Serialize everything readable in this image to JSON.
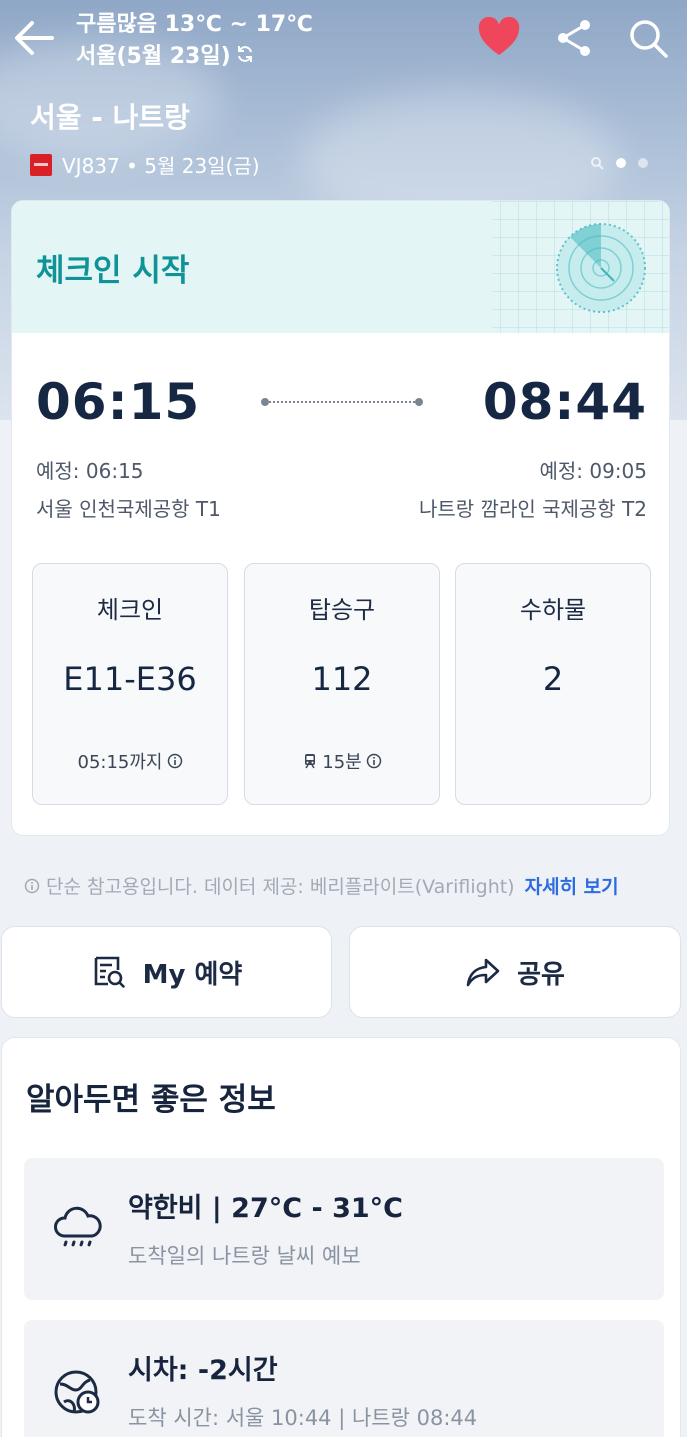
{
  "header": {
    "weather_line": "구름많음 13℃ ~ 17℃",
    "location_line": "서울(5월 23일)",
    "route": "서울 - 나트랑",
    "flight": "VJ837 • 5월 23일(금)"
  },
  "flight_card": {
    "status": "체크인 시작",
    "departure_time": "06:15",
    "arrival_time": "08:44",
    "departure_scheduled": "예정: 06:15",
    "arrival_scheduled": "예정: 09:05",
    "departure_airport": "서울 인천국제공항 T1",
    "arrival_airport": "나트랑 깜라인 국제공항 T2",
    "tiles": [
      {
        "label": "체크인",
        "value": "E11-E36",
        "note": "05:15까지"
      },
      {
        "label": "탑승구",
        "value": "112",
        "note": "15분"
      },
      {
        "label": "수하물",
        "value": "2",
        "note": ""
      }
    ]
  },
  "disclaimer": {
    "text": "단순 참고용입니다. 데이터 제공: 베리플라이트(Variflight)",
    "link": "자세히 보기"
  },
  "actions": {
    "my_booking": "My 예약",
    "share": "공유"
  },
  "info": {
    "title": "알아두면 좋은 정보",
    "items": [
      {
        "heading": "약한비 | 27°C - 31°C",
        "sub": "도착일의 나트랑 날씨 예보",
        "icon": "rain-cloud-icon"
      },
      {
        "heading": "시차: -2시간",
        "sub": "도착 시간: 서울 10:44 | 나트랑 08:44",
        "icon": "globe-clock-icon"
      }
    ]
  },
  "colors": {
    "status_teal": "#0f9397",
    "heart": "#f0465c",
    "link_blue": "#2d6cdf"
  }
}
